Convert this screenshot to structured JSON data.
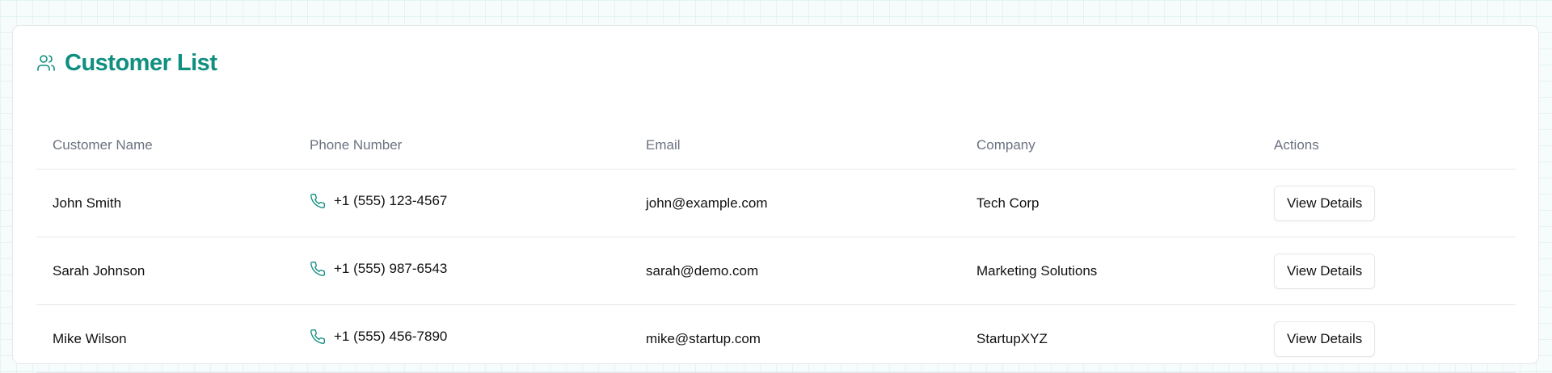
{
  "card": {
    "title": "Customer List",
    "icon": "users-icon"
  },
  "table": {
    "headers": [
      "Customer Name",
      "Phone Number",
      "Email",
      "Company",
      "Actions"
    ],
    "rows": [
      {
        "name": "John Smith",
        "phone": "+1 (555) 123-4567",
        "email": "john@example.com",
        "company": "Tech Corp",
        "action": "View Details"
      },
      {
        "name": "Sarah Johnson",
        "phone": "+1 (555) 987-6543",
        "email": "sarah@demo.com",
        "company": "Marketing Solutions",
        "action": "View Details"
      },
      {
        "name": "Mike Wilson",
        "phone": "+1 (555) 456-7890",
        "email": "mike@startup.com",
        "company": "StartupXYZ",
        "action": "View Details"
      }
    ]
  },
  "colors": {
    "accent": "#0f8f7f",
    "header_text": "#6b7280",
    "border": "#e5e7eb"
  },
  "icons": {
    "phone": "phone-icon"
  }
}
